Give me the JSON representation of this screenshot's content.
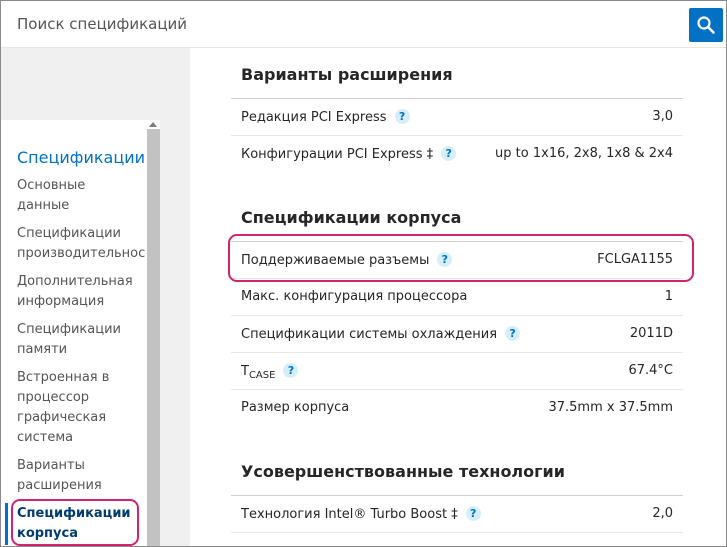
{
  "search": {
    "placeholder": "Поиск спецификаций",
    "button_icon": "search-icon"
  },
  "sidebar": {
    "title": "Спецификации",
    "items": [
      {
        "label": "Основные данные",
        "lines": [
          "Основные",
          "данные"
        ]
      },
      {
        "label": "Спецификации производительности",
        "lines": [
          "Спецификации",
          "производительност"
        ]
      },
      {
        "label": "Дополнительная информация",
        "lines": [
          "Дополнительная",
          "информация"
        ]
      },
      {
        "label": "Спецификации памяти",
        "lines": [
          "Спецификации",
          "памяти"
        ]
      },
      {
        "label": "Встроенная в процессор графическая система",
        "lines": [
          "Встроенная в",
          "процессор",
          "графическая",
          "система"
        ]
      },
      {
        "label": "Варианты расширения",
        "lines": [
          "Варианты",
          "расширения"
        ]
      },
      {
        "label": "Спецификации корпуса",
        "lines": [
          "Спецификации",
          "корпуса"
        ],
        "active": true
      }
    ]
  },
  "sections": [
    {
      "title": "Варианты расширения",
      "rows": [
        {
          "label": "Редакция PCI Express",
          "help": "?",
          "value": "3,0"
        },
        {
          "label": "Конфигурации PCI Express ‡",
          "help": "?",
          "value": "up to 1x16, 2x8, 1x8 & 2x4"
        }
      ]
    },
    {
      "title": "Спецификации корпуса",
      "rows": [
        {
          "label": "Поддерживаемые разъемы",
          "help": "?",
          "value": "FCLGA1155"
        },
        {
          "label": "Макс. конфигурация процессора",
          "value": "1"
        },
        {
          "label": "Спецификации системы охлаждения",
          "help": "?",
          "value": "2011D"
        },
        {
          "label_main": "T",
          "label_sub": "CASE",
          "help": "?",
          "value": "67.4°C"
        },
        {
          "label": "Размер корпуса",
          "value": "37.5mm x 37.5mm"
        }
      ]
    },
    {
      "title": "Усовершенствованные технологии",
      "rows": [
        {
          "label": "Технология Intel® Turbo Boost ‡",
          "help": "?",
          "value": "2,0"
        }
      ]
    }
  ],
  "colors": {
    "accent": "#0071c5",
    "highlight": "#d1246c",
    "active_nav": "#003c71"
  }
}
